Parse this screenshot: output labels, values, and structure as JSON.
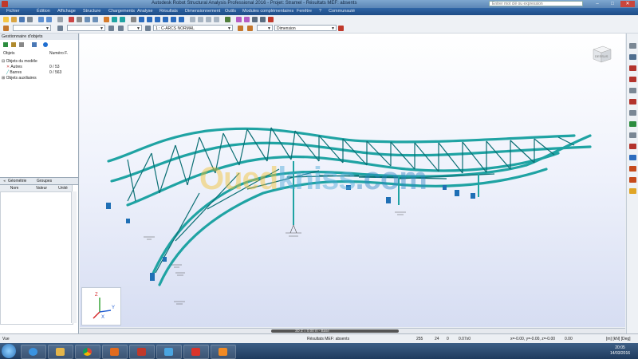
{
  "window": {
    "title": "Autodesk Robot Structural Analysis Professional 2016 - Projet: Stramel - Résultats MEF: absents",
    "search_placeholder": "Entrer mot clé ou expression",
    "minimize": "–",
    "maximize": "□",
    "close": "✕"
  },
  "menu": [
    "Fichier",
    "Édition",
    "Affichage",
    "Structure",
    "Chargements",
    "Analyse",
    "Résultats",
    "Dimensionnement",
    "Outils",
    "Modules complémentaires",
    "Fenêtre",
    "?",
    "Communauté"
  ],
  "toolbar2": {
    "view_combo": "",
    "section_combo": "1 : C-ARCS NORMAL",
    "dim_combo": "Dimension"
  },
  "left_panel": {
    "header": "Gestionnaire d'objets",
    "col_name": "Objets",
    "col_number": "Numéro F.",
    "tree": [
      {
        "label": "Objets du modèle",
        "value": ""
      },
      {
        "label": "Autres",
        "value": "0 / 53"
      },
      {
        "label": "Barres",
        "value": "0 / 563"
      },
      {
        "label": "Objets auxiliaires",
        "value": ""
      }
    ],
    "tabs": [
      "Géométrie",
      "Groupes"
    ],
    "table_headers": [
      "Nom",
      "Valeur",
      "Unité"
    ]
  },
  "viewport": {
    "viewcube_label": "DESSUS",
    "axis_labels": [
      "Z",
      "Y",
      "X"
    ],
    "scroll_label": "3D   Z = 0.00 m - Base"
  },
  "watermark": {
    "part1": "Oued",
    "part2": "kniss",
    "part3": ".com"
  },
  "statusbar": {
    "left": "Vue",
    "results": "Résultats MEF: absents",
    "n1": "255",
    "n2": "24",
    "n3": "0",
    "n4": "0.07x0",
    "coords": "x=-0.00, y=-0.00, z=-0.00",
    "n5": "0.00",
    "units": "[m] [kN] [Deg]"
  },
  "taskbar": {
    "time": "20:05",
    "date": "14/03/2016"
  },
  "colors": {
    "structure": "#1fa3a3",
    "structure_dark": "#0b6f74",
    "support": "#1f6fb5",
    "menubar": "#1d4c86"
  }
}
